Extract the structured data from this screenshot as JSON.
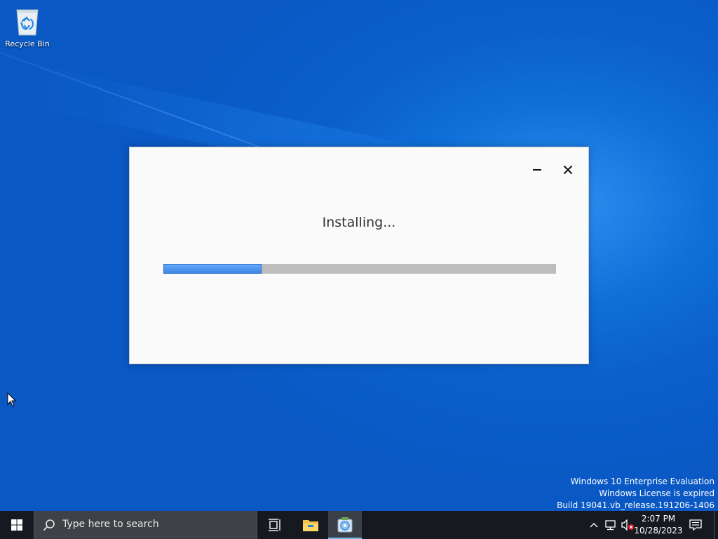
{
  "desktop": {
    "recycle_bin_label": "Recycle Bin",
    "watermark": {
      "line1": "Windows 10 Enterprise Evaluation",
      "line2": "Windows License is expired",
      "line3": "Build 19041.vb_release.191206-1406"
    }
  },
  "dialog": {
    "status_text": "Installing...",
    "progress_fraction": 0.25,
    "minimize_icon": "minimize-icon",
    "close_icon": "close-icon"
  },
  "taskbar": {
    "search_placeholder": "Type here to search",
    "clock_time": "2:07 PM",
    "clock_date": "10/28/2023",
    "icons": [
      "windows-start-icon",
      "search-icon",
      "task-view-icon",
      "file-explorer-icon",
      "installer-app-icon",
      "chevron-up-icon",
      "network-icon",
      "volume-muted-icon",
      "notifications-icon"
    ]
  },
  "colors": {
    "desktop_blue": "#0b5fcc",
    "progress_blue": "#3b86e6",
    "taskbar": "#161a20"
  }
}
